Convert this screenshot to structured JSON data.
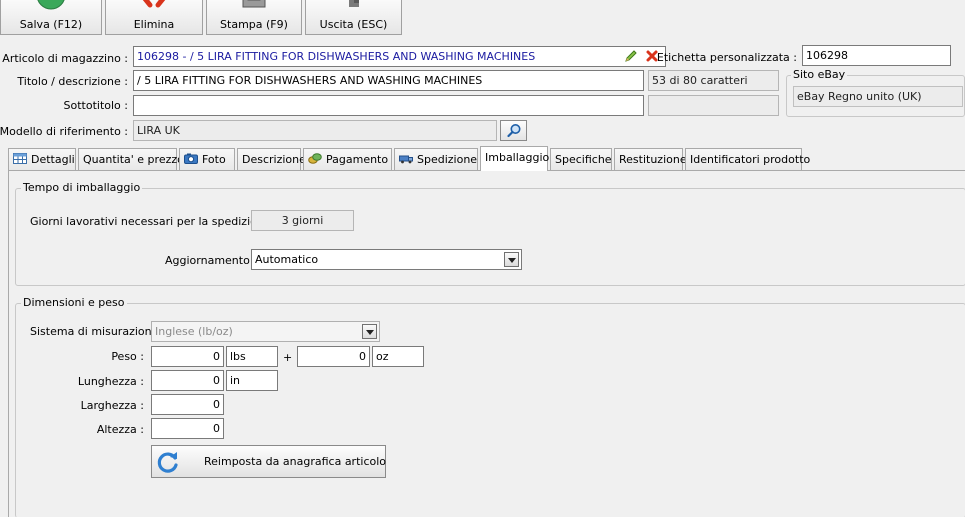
{
  "toolbar": {
    "save_label": "Salva (F12)",
    "delete_label": "Elimina",
    "print_label": "Stampa (F9)",
    "exit_label": "Uscita (ESC)"
  },
  "header": {
    "article_label": "Articolo di magazzino :",
    "article_value": "106298 - / 5 LIRA FITTING FOR DISHWASHERS AND WASHING MACHINES",
    "custom_label_label": "Etichetta personalizzata :",
    "custom_label_value": "106298",
    "title_label": "Titolo / descrizione :",
    "title_value": "/ 5 LIRA FITTING FOR DISHWASHERS AND WASHING MACHINES",
    "title_counter": "53 di 80 caratteri",
    "subtitle_label": "Sottotitolo :",
    "subtitle_value": "",
    "subtitle_counter": "",
    "site_group_title": "Sito eBay",
    "site_value": "eBay Regno unito (UK)",
    "model_label": "Modello di riferimento :",
    "model_value": "LIRA UK"
  },
  "tabs": [
    {
      "label": "Dettagli",
      "icon": "table-icon"
    },
    {
      "label": "Quantita' e prezzo",
      "icon": ""
    },
    {
      "label": "Foto",
      "icon": "camera-icon"
    },
    {
      "label": "Descrizione",
      "icon": ""
    },
    {
      "label": "Pagamento",
      "icon": "coins-icon"
    },
    {
      "label": "Spedizione",
      "icon": "truck-icon"
    },
    {
      "label": "Imballaggio",
      "icon": ""
    },
    {
      "label": "Specifiche",
      "icon": ""
    },
    {
      "label": "Restituzione",
      "icon": ""
    },
    {
      "label": "Identificatori prodotto",
      "icon": ""
    }
  ],
  "active_tab": "Imballaggio",
  "packaging": {
    "group_title": "Tempo di imballaggio",
    "days_label": "Giorni lavorativi necessari per la spedizione :",
    "days_value": "3 giorni",
    "update_label": "Aggiornamento :",
    "update_value": "Automatico"
  },
  "dimensions": {
    "group_title": "Dimensioni e peso",
    "system_label": "Sistema di misurazione :",
    "system_value": "Inglese (lb/oz)",
    "weight_label": "Peso :",
    "weight_lbs": "0",
    "weight_lbs_unit": "lbs",
    "plus": "+",
    "weight_oz": "0",
    "weight_oz_unit": "oz",
    "length_label": "Lunghezza :",
    "length_value": "0",
    "length_unit": "in",
    "width_label": "Larghezza :",
    "width_value": "0",
    "height_label": "Altezza :",
    "height_value": "0",
    "reset_label": "Reimposta da anagrafica articolo"
  },
  "colors": {
    "save_green": "#3aa85a",
    "delete_red": "#d9341c",
    "article_text_blue": "#1a1aa0"
  }
}
